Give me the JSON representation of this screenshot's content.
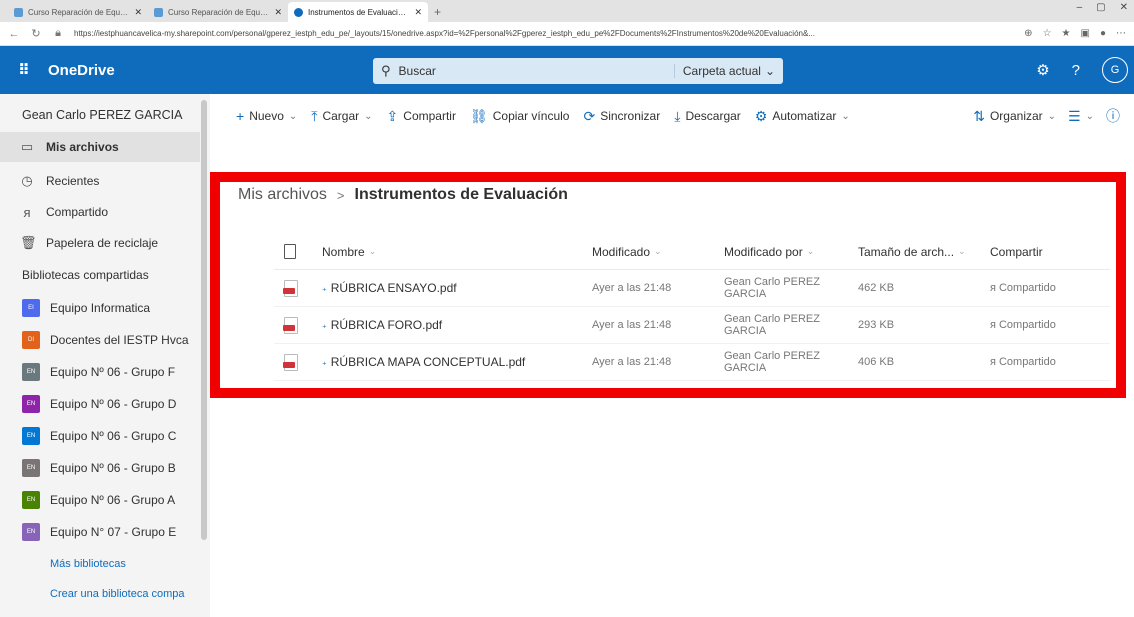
{
  "browser": {
    "tabs": [
      {
        "label": "Curso Reparación de Equipos n",
        "color": "#5b9bd5",
        "active": false
      },
      {
        "label": "Curso Reparación de Equipos n",
        "color": "#5b9bd5",
        "active": false
      },
      {
        "label": "Instrumentos de Evaluación - Or",
        "color": "#0f6cbd",
        "active": true
      }
    ],
    "new_tab": "+",
    "window_controls": [
      "–",
      "▢",
      "✕"
    ],
    "url": "https://iestphuancavelica-my.sharepoint.com/personal/gperez_iestph_edu_pe/_layouts/15/onedrive.aspx?id=%2Fpersonal%2Fgperez_iestph_edu_pe%2FDocuments%2FInstrumentos%20de%20Evaluación&..."
  },
  "suite": {
    "app_title": "OneDrive",
    "search_placeholder": "Buscar",
    "scope": "Carpeta actual",
    "avatar_initial": "G",
    "accent": "#0f6cbd"
  },
  "sidebar": {
    "user_name": "Gean Carlo PEREZ GARCIA",
    "items": [
      {
        "label": "Mis archivos",
        "icon": "folder-icon",
        "selected": true
      },
      {
        "label": "Recientes",
        "icon": "clock-icon",
        "selected": false
      },
      {
        "label": "Compartido",
        "icon": "people-icon",
        "selected": false
      },
      {
        "label": "Papelera de reciclaje",
        "icon": "trash-icon",
        "selected": false
      }
    ],
    "section_title": "Bibliotecas compartidas",
    "libraries": [
      {
        "label": "Equipo Informatica",
        "color": "#4f6bed",
        "tile": "EI"
      },
      {
        "label": "Docentes del IESTP Hvca",
        "color": "#e3621b",
        "tile": "DI"
      },
      {
        "label": "Equipo Nº 06 - Grupo F",
        "color": "#69797e",
        "tile": "EN"
      },
      {
        "label": "Equipo Nº 06 - Grupo D",
        "color": "#8e24aa",
        "tile": "EN"
      },
      {
        "label": "Equipo Nº 06 - Grupo C",
        "color": "#0078d4",
        "tile": "EN"
      },
      {
        "label": "Equipo Nº 06 - Grupo B",
        "color": "#7a7574",
        "tile": "EN"
      },
      {
        "label": "Equipo Nº 06 - Grupo A",
        "color": "#498205",
        "tile": "EN"
      },
      {
        "label": "Equipo N° 07 - Grupo E",
        "color": "#8764b8",
        "tile": "EN"
      }
    ],
    "more_libraries": "Más bibliotecas",
    "create_library": "Crear una biblioteca compa"
  },
  "commands": [
    {
      "label": "Nuevo",
      "icon": "plus-icon",
      "glyph": "+",
      "dropdown": true
    },
    {
      "label": "Cargar",
      "icon": "upload-icon",
      "glyph": "⤒",
      "dropdown": true
    },
    {
      "label": "Compartir",
      "icon": "share-icon",
      "glyph": "⇪",
      "dropdown": false
    },
    {
      "label": "Copiar vínculo",
      "icon": "link-icon",
      "glyph": "⛓",
      "dropdown": false
    },
    {
      "label": "Sincronizar",
      "icon": "sync-icon",
      "glyph": "⟳",
      "dropdown": false
    },
    {
      "label": "Descargar",
      "icon": "download-icon",
      "glyph": "⤓",
      "dropdown": false
    },
    {
      "label": "Automatizar",
      "icon": "flow-icon",
      "glyph": "⚙",
      "dropdown": true
    }
  ],
  "commands_right": {
    "sort_label": "Organizar"
  },
  "breadcrumb": {
    "root": "Mis archivos",
    "separator": ">",
    "current": "Instrumentos de Evaluación"
  },
  "table": {
    "columns": {
      "name": "Nombre",
      "modified": "Modificado",
      "modified_by": "Modificado por",
      "size": "Tamaño de arch...",
      "sharing": "Compartir"
    },
    "rows": [
      {
        "name": "RÚBRICA ENSAYO.pdf",
        "modified": "Ayer a las 21:48",
        "modified_by": "Gean Carlo PEREZ GARCIA",
        "size": "462 KB",
        "sharing": "Compartido"
      },
      {
        "name": "RÚBRICA FORO.pdf",
        "modified": "Ayer a las 21:48",
        "modified_by": "Gean Carlo PEREZ GARCIA",
        "size": "293 KB",
        "sharing": "Compartido"
      },
      {
        "name": "RÚBRICA MAPA CONCEPTUAL.pdf",
        "modified": "Ayer a las 21:48",
        "modified_by": "Gean Carlo PEREZ GARCIA",
        "size": "406 KB",
        "sharing": "Compartido"
      }
    ]
  },
  "highlight_color": "#f00000"
}
